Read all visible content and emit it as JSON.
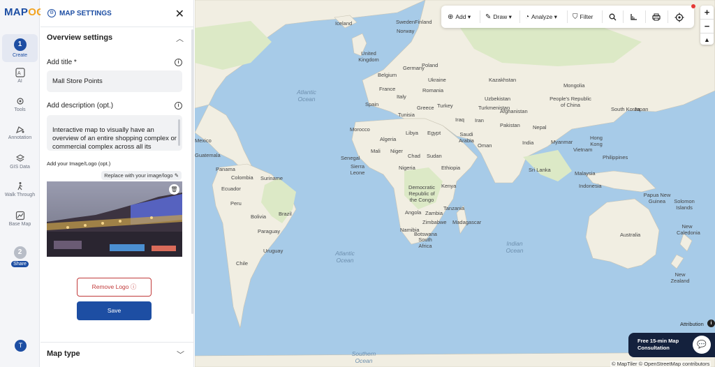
{
  "app": {
    "logo_main": "MAP",
    "logo_accent": "OG"
  },
  "rail": {
    "create": {
      "step": "1",
      "label": "Create"
    },
    "items": [
      {
        "label": "AI",
        "icon": "ai-icon"
      },
      {
        "label": "Tools",
        "icon": "tools-icon"
      },
      {
        "label": "Annotation",
        "icon": "annotation-icon"
      },
      {
        "label": "GIS Data",
        "icon": "layers-icon"
      },
      {
        "label": "Walk Through",
        "icon": "walk-icon"
      },
      {
        "label": "Base Map",
        "icon": "basemap-icon"
      }
    ],
    "share": {
      "step": "2",
      "label": "Share"
    },
    "avatar": "T"
  },
  "panel": {
    "header_title": "MAP SETTINGS",
    "close": "✕",
    "overview_title": "Overview settings",
    "title_label": "Add title *",
    "title_value": "Mall Store Points",
    "desc_label": "Add description (opt.)",
    "desc_value": "Interactive map to visually have an overview of an entire shopping complex or commercial complex across all its",
    "image_label": "Add your Image/Logo (opt.)",
    "replace_label": "Replace with your image/logo",
    "remove_logo": "Remove Logo",
    "save": "Save",
    "map_type": "Map type"
  },
  "toolbar": {
    "add": "Add",
    "draw": "Draw",
    "analyze": "Analyze",
    "filter": "Filter"
  },
  "map": {
    "labels": [
      "Iceland",
      "Sweden",
      "Finland",
      "Norway",
      "United Kingdom",
      "Belgium",
      "Germany",
      "Poland",
      "Ukraine",
      "Kazakhstan",
      "Mongolia",
      "France",
      "Spain",
      "Italy",
      "Romania",
      "Uzbekistan",
      "Turkey",
      "Greece",
      "Turkmenistan",
      "Afghanistan",
      "People's Republic of China",
      "South Korea",
      "Japan",
      "Tunisia",
      "Morocco",
      "Iraq",
      "Iran",
      "Pakistan",
      "Algeria",
      "Libya",
      "Egypt",
      "Saudi Arabia",
      "Nepal",
      "Myanmar",
      "Hong Kong",
      "Philippines",
      "Mali",
      "Niger",
      "Chad",
      "Sudan",
      "Oman",
      "India",
      "Vietnam",
      "Senegal",
      "Sierra Leone",
      "Nigeria",
      "Ethiopia",
      "Sri Lanka",
      "Mexico",
      "Guatemala",
      "Panama",
      "Colombia",
      "Suriname",
      "Ecuador",
      "Democratic Republic of the Congo",
      "Kenya",
      "Malaysia",
      "Indonesia",
      "Papua New Guinea",
      "Solomon Islands",
      "Peru",
      "Brazil",
      "Bolivia",
      "Tanzania",
      "Paraguay",
      "Angola",
      "Zambia",
      "Namibia",
      "Zimbabwe",
      "Madagascar",
      "Botswana",
      "South Africa",
      "Uruguay",
      "Chile",
      "Australia",
      "New Caledonia",
      "New Zealand"
    ],
    "oceans": {
      "atlantic_north": "Atlantic Ocean",
      "atlantic_south": "Atlantic Ocean",
      "indian": "Indian Ocean",
      "southern": "Southern Ocean"
    },
    "attribution": "Attribution",
    "consult": "Free 15-min Map Consultation",
    "copyright": "© MapTiler © OpenStreetMap contributors"
  },
  "colors": {
    "brand": "#1d4ea3",
    "accent": "#f2a31f",
    "danger": "#c13a3a",
    "water": "#a7cbe8",
    "land": "#f2efe4"
  }
}
